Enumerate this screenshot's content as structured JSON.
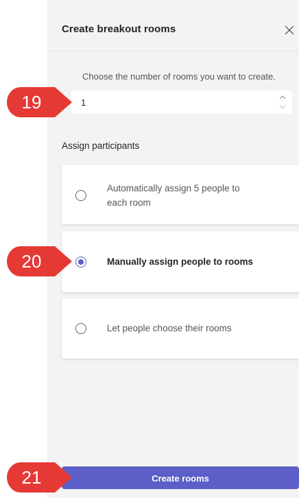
{
  "panel": {
    "title": "Create breakout rooms",
    "close_icon": "close-icon"
  },
  "rooms": {
    "instruction": "Choose the number of rooms you want to create.",
    "value": "1",
    "stepper_icons": [
      "chevron-up-icon",
      "chevron-down-icon"
    ]
  },
  "assign": {
    "heading": "Assign participants",
    "options": [
      {
        "label_line1": "Automatically assign 5 people to",
        "label_line2": "each room",
        "selected": false
      },
      {
        "label": "Manually assign people to rooms",
        "selected": true
      },
      {
        "label": "Let people choose their rooms",
        "selected": false
      }
    ]
  },
  "create_button_label": "Create rooms",
  "callouts": [
    "19",
    "20",
    "21"
  ],
  "colors": {
    "accent": "#5b5fc7",
    "callout": "#e53935",
    "panel_bg": "#f3f3f3"
  }
}
